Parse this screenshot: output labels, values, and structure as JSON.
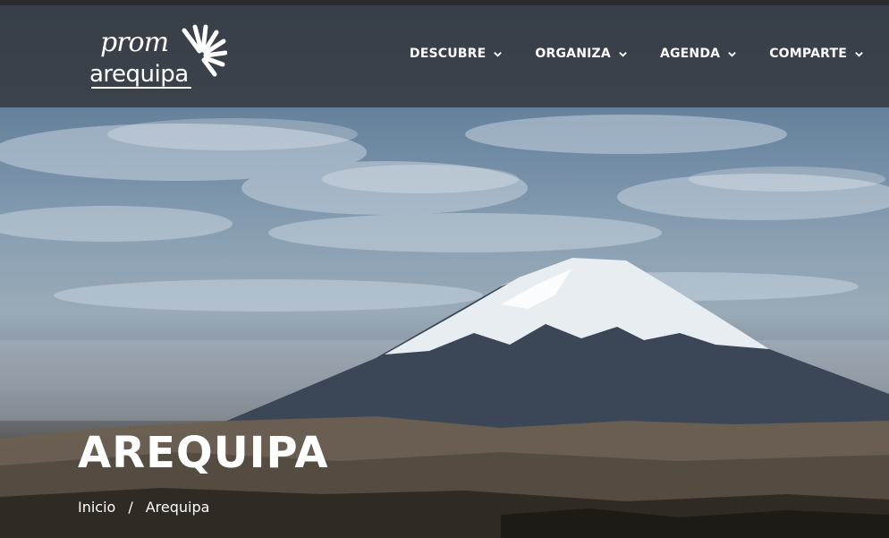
{
  "brand": {
    "script_text": "prom",
    "word_text": "arequipa",
    "logo_label": "promarequipa"
  },
  "nav": {
    "items": [
      {
        "label": "DESCUBRE",
        "icon": "chevron-down-icon"
      },
      {
        "label": "ORGANIZA",
        "icon": "chevron-down-icon"
      },
      {
        "label": "AGENDA",
        "icon": "chevron-down-icon"
      },
      {
        "label": "COMPARTE",
        "icon": "chevron-down-icon"
      }
    ]
  },
  "hero": {
    "title": "AREQUIPA",
    "breadcrumb": {
      "home": "Inicio",
      "separator": "/",
      "current": "Arequipa"
    }
  },
  "colors": {
    "navbar_bg": "#34383e",
    "text": "#ffffff",
    "snow": "#e8edf2",
    "mountain": "#3b4756"
  }
}
